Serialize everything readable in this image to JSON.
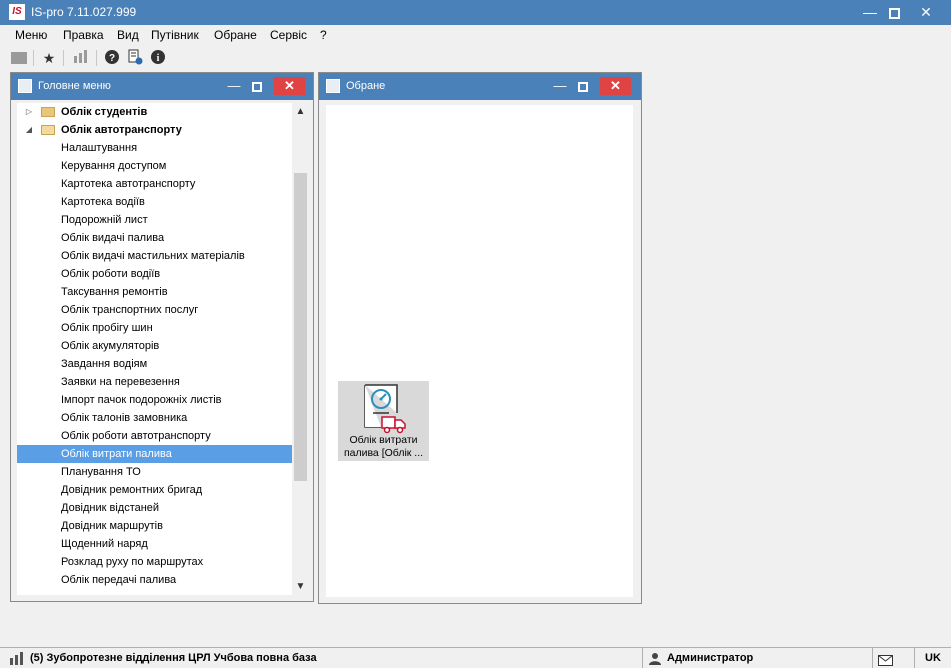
{
  "window": {
    "logo": "IS",
    "title": "IS-pro 7.11.027.999",
    "brand_color": "#4a81b9"
  },
  "menubar": {
    "items": [
      "Меню",
      "Правка",
      "Вид",
      "Путівник",
      "Обране",
      "Сервіс",
      "?"
    ]
  },
  "toolbar": {
    "icons": [
      "folder-icon",
      "star-icon",
      "chart-icon",
      "help-icon",
      "document-info-icon",
      "info-icon"
    ]
  },
  "main_menu": {
    "title": "Головне меню",
    "folders": [
      {
        "label": "Облік студентів",
        "expanded": false
      },
      {
        "label": "Облік автотранспорту",
        "expanded": true
      }
    ],
    "items": [
      "Налаштування",
      "Керування доступом",
      "Картотека автотранспорту",
      "Картотека водіїв",
      "Подорожній лист",
      "Облік видачі палива",
      "Облік видачі мастильних матеріалів",
      "Облік роботи водіїв",
      "Таксування ремонтів",
      "Облік транспортних послуг",
      "Облік пробігу шин",
      "Облік акумуляторів",
      "Завдання водіям",
      "Заявки на перевезення",
      "Імпорт пачок подорожніх листів",
      "Облік талонів замовника",
      "Облік роботи автотранспорту",
      "Облік витрати палива",
      "Планування ТО",
      "Довідник ремонтних бригад",
      "Довідник відстаней",
      "Довідник маршрутів",
      "Щоденний наряд",
      "Розклад руху по маршрутах",
      "Облік передачі палива"
    ],
    "selected_index": 17
  },
  "favorites": {
    "title": "Обране",
    "tile_label_line1": "Облік витрати",
    "tile_label_line2": "палива [Облік ..."
  },
  "statusbar": {
    "database": "(5) Зубопротезне відділення ЦРЛ Учбова повна база",
    "user": "Администратор",
    "language": "UK"
  }
}
